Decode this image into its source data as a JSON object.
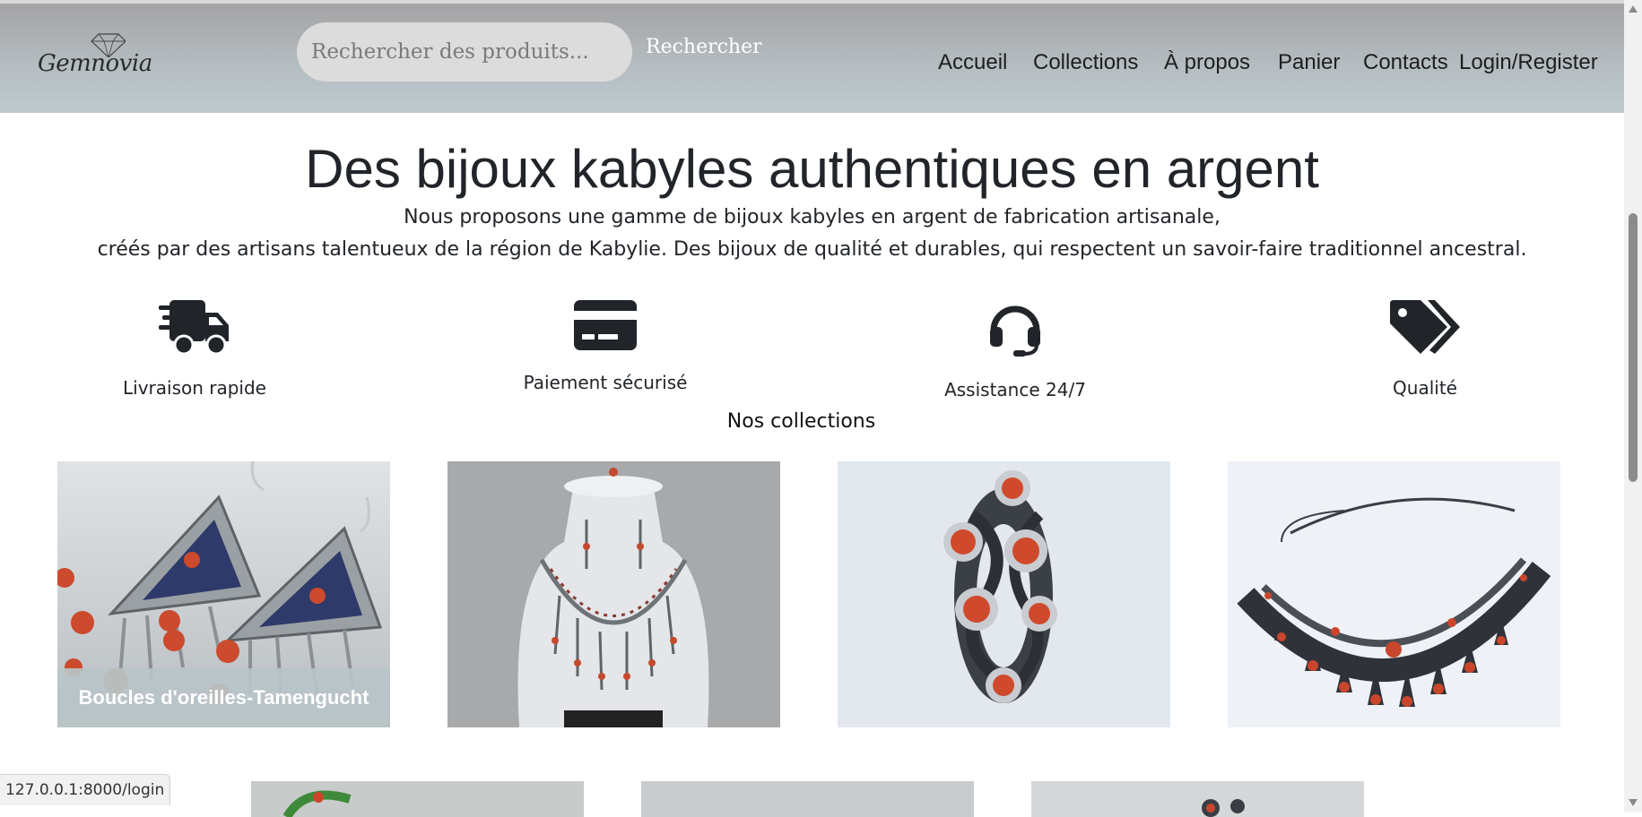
{
  "brand": {
    "name": "Gemnovia"
  },
  "search": {
    "placeholder": "Rechercher des produits...",
    "button_label": "Rechercher"
  },
  "nav": {
    "items": [
      {
        "label": "Accueil"
      },
      {
        "label": "Collections"
      },
      {
        "label": "À propos"
      },
      {
        "label": "Panier"
      },
      {
        "label": "Contacts"
      },
      {
        "label": "Login/Register"
      }
    ]
  },
  "hero": {
    "title": "Des bijoux kabyles authentiques en argent",
    "line1": "Nous proposons une gamme de bijoux kabyles en argent de fabrication artisanale,",
    "line2": "créés par des artisans talentueux de la région de Kabylie. Des bijoux de qualité et durables, qui respectent un savoir-faire traditionnel ancestral."
  },
  "features": [
    {
      "icon": "truck-fast-icon",
      "label": "Livraison rapide"
    },
    {
      "icon": "credit-card-icon",
      "label": "Paiement sécurisé"
    },
    {
      "icon": "headset-icon",
      "label": "Assistance 24/7"
    },
    {
      "icon": "tags-icon",
      "label": "Qualité"
    }
  ],
  "collections": {
    "title": "Nos collections",
    "cards": [
      {
        "caption": "Boucles d'oreilles-Tamengucht"
      },
      {
        "caption": ""
      },
      {
        "caption": ""
      },
      {
        "caption": ""
      }
    ]
  },
  "status_bar": {
    "url": "127.0.0.1:8000/login"
  },
  "colors": {
    "navbar_top": "#a3a3a4",
    "navbar_bottom": "#bdcbcf",
    "icon": "#212529",
    "coral": "#d1472c"
  }
}
